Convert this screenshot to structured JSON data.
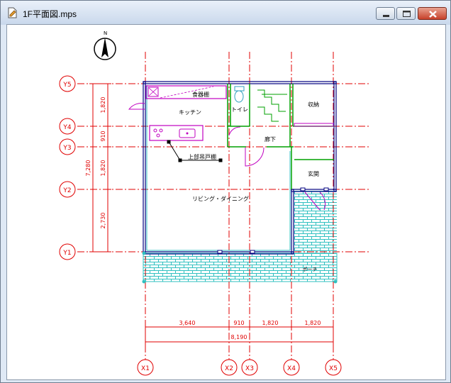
{
  "window": {
    "title": "1F平面図.mps"
  },
  "icons": {
    "app": "document-icon",
    "minimize": "minimize-icon",
    "maximize": "maximize-icon",
    "close": "close-icon",
    "north": "north-arrow-icon"
  },
  "compass": {
    "label": "N"
  },
  "grid_x": [
    {
      "label": "X1"
    },
    {
      "label": "X2"
    },
    {
      "label": "X3"
    },
    {
      "label": "X4"
    },
    {
      "label": "X5"
    }
  ],
  "grid_y": [
    {
      "label": "Y5"
    },
    {
      "label": "Y4"
    },
    {
      "label": "Y3"
    },
    {
      "label": "Y2"
    },
    {
      "label": "Y1"
    }
  ],
  "dims_bottom": {
    "segments": [
      "3,640",
      "910",
      "1,820",
      "1,820"
    ],
    "total": "8,190"
  },
  "dims_left": {
    "segments": [
      "1,820",
      "910",
      "1,820",
      "2,730"
    ],
    "total": "7,280"
  },
  "rooms": {
    "shokki": "食器棚",
    "kitchen": "キッチン",
    "toilet": "トイレ",
    "storage": "収納",
    "hallway": "廊下",
    "upper_cabinet": "上部吊戸棚",
    "entrance": "玄関",
    "living": "リビング・ダイニング",
    "porch": "ポーチ"
  },
  "colors": {
    "grid": "#e00000",
    "wall": "#000080",
    "fixture": "#c000c0",
    "green": "#00a000",
    "tile": "#30c0c0"
  }
}
